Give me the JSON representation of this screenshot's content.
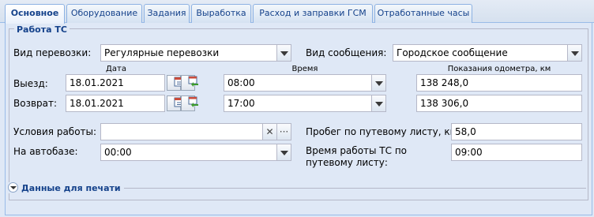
{
  "tabs": [
    {
      "label": "Основное",
      "active": true
    },
    {
      "label": "Оборудование"
    },
    {
      "label": "Задания"
    },
    {
      "label": "Выработка"
    },
    {
      "label": "Расход и заправки ГСМ"
    },
    {
      "label": "Отработанные часы"
    }
  ],
  "section": {
    "title": "Работа ТС",
    "transport_type_label": "Вид перевозки:",
    "transport_type_value": "Регулярные перевозки",
    "route_type_label": "Вид сообщения:",
    "route_type_value": "Городское сообщение",
    "col_date": "Дата",
    "col_time": "Время",
    "col_odometer": "Показания одометра, км",
    "departure_label": "Выезд:",
    "departure_date": "18.01.2021",
    "departure_time": "08:00",
    "departure_odometer": "138 248,0",
    "return_label": "Возврат:",
    "return_date": "18.01.2021",
    "return_time": "17:00",
    "return_odometer": "138 306,0",
    "conditions_label": "Условия работы:",
    "conditions_value": "",
    "depot_label": "На автобазе:",
    "depot_value": "00:00",
    "mileage_label": "Пробег по путевому листу, км:",
    "mileage_value": "58,0",
    "worktime_label": "Время работы ТС по путевому листу:",
    "worktime_value": "09:00"
  },
  "print_section": {
    "title": "Данные для печати"
  },
  "icons": {
    "clear": "✕",
    "more": "···"
  }
}
